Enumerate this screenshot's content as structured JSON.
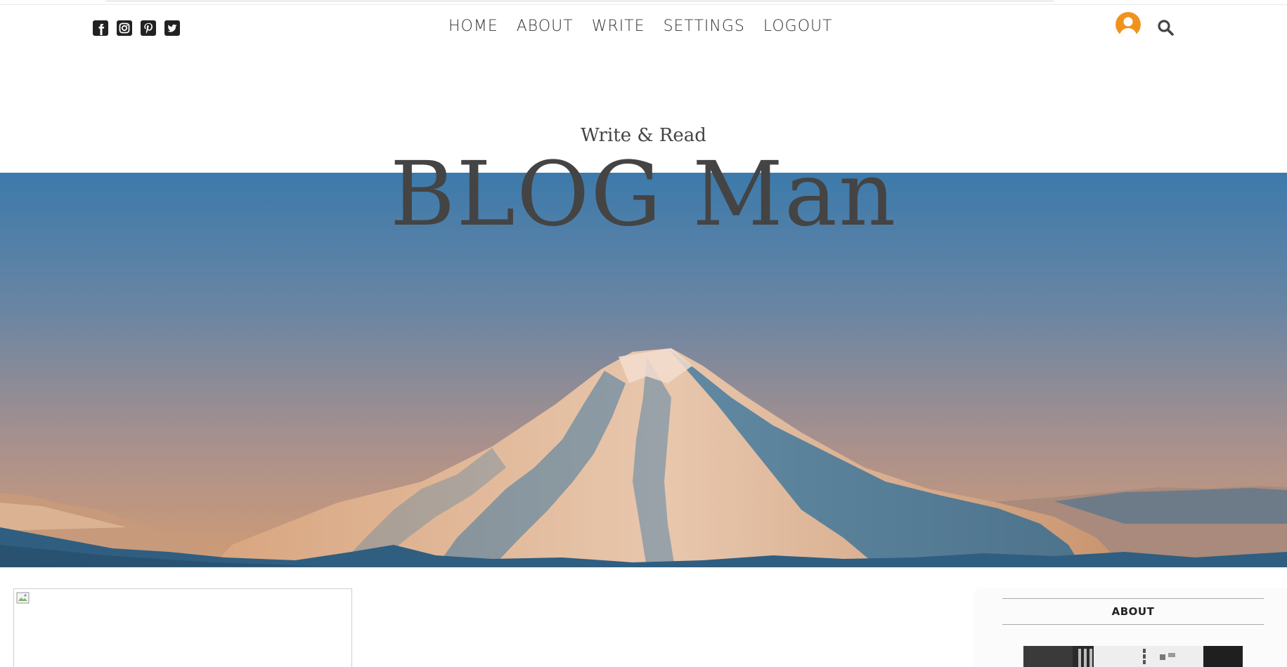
{
  "social": [
    {
      "name": "facebook-icon"
    },
    {
      "name": "instagram-icon"
    },
    {
      "name": "pinterest-icon"
    },
    {
      "name": "twitter-icon"
    }
  ],
  "nav": {
    "home": "HOME",
    "about": "ABOUT",
    "write": "WRITE",
    "settings": "SETTINGS",
    "logout": "LOGOUT"
  },
  "header": {
    "subtitle": "Write & Read",
    "title": "BLOG Man"
  },
  "sidebar": {
    "title": "ABOUT"
  },
  "colors": {
    "text": "#444444",
    "nav_text": "#333333",
    "sky_top": "#3e7bab",
    "sky_bottom": "#c99a78",
    "avatar": "#f0931e"
  }
}
